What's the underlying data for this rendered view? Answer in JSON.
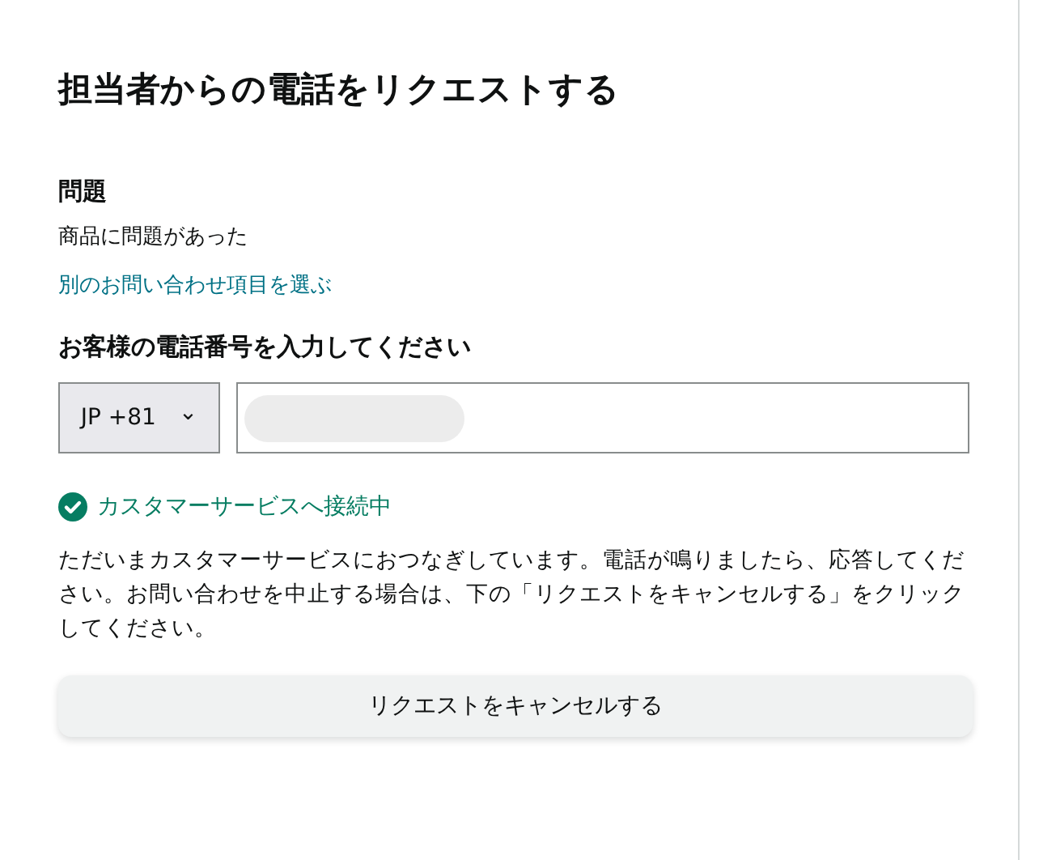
{
  "title": "担当者からの電話をリクエストする",
  "issue": {
    "heading": "問題",
    "value": "商品に問題があった",
    "link": "別のお問い合わせ項目を選ぶ"
  },
  "phone": {
    "heading": "お客様の電話番号を入力してください",
    "country_code": "JP +81",
    "caret": "⌄"
  },
  "status": {
    "connected": true,
    "text": "カスタマーサービスへ接続中"
  },
  "message": "ただいまカスタマーサービスにおつなぎしています。電話が鳴りましたら、応答してください。お問い合わせを中止する場合は、下の「リクエストをキャンセルする」をクリックしてください。",
  "buttons": [
    "リクエストをキャンセルする"
  ]
}
